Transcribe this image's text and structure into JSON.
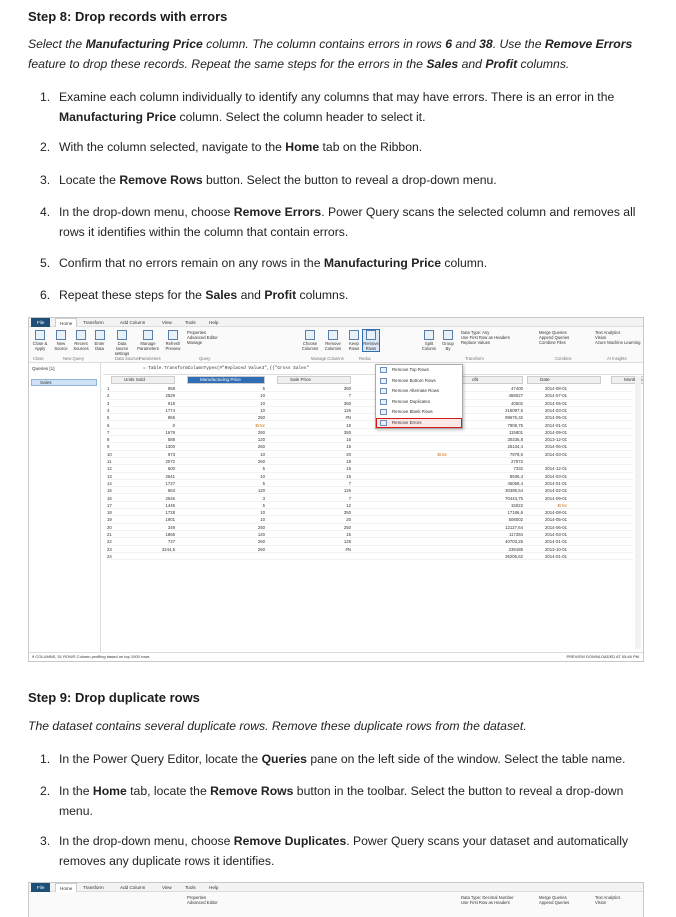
{
  "step8": {
    "heading": "Step 8: Drop records with errors",
    "intro_parts": [
      "Select the ",
      "Manufacturing Price",
      " column. The column contains errors in rows ",
      "6",
      " and ",
      "38",
      ". Use the ",
      "Remove Errors",
      " feature to drop these records. Repeat the same steps for the errors in the ",
      "Sales",
      " and ",
      "Profit",
      " columns."
    ],
    "items": [
      {
        "num": "1.",
        "parts": [
          "Examine each column individually to identify any columns that may have errors. There is an error in the ",
          "Manufacturing Price",
          " column. Select the column header to select it."
        ]
      },
      {
        "num": "2.",
        "parts": [
          "With the column selected, navigate to the ",
          "Home",
          " tab on the Ribbon."
        ]
      },
      {
        "num": "3.",
        "parts": [
          "Locate the ",
          "Remove Rows",
          " button. Select the button to reveal a drop-down menu."
        ]
      },
      {
        "num": "4.",
        "parts": [
          "In the drop-down menu, choose ",
          "Remove Errors",
          ". Power Query scans the selected column and removes all rows it identifies within the column that contain errors."
        ]
      },
      {
        "num": "5.",
        "parts": [
          "Confirm that no errors remain on any rows in the ",
          "Manufacturing Price",
          " column."
        ]
      },
      {
        "num": "6.",
        "parts": [
          "Repeat these steps for the ",
          "Sales",
          " and ",
          "Profit",
          " columns."
        ]
      }
    ]
  },
  "pq": {
    "tabs": [
      "File",
      "Home",
      "Transform",
      "Add Column",
      "View",
      "Tools",
      "Help"
    ],
    "ribbon_buttons": [
      "Close & Apply",
      "New Source",
      "Recent Sources",
      "Enter Data",
      "Data source settings",
      "Manage Parameters",
      "Refresh Preview",
      "Choose Columns",
      "Remove Columns",
      "Keep Rows",
      "Remove Rows",
      "Split Column",
      "Group By"
    ],
    "ribbon_small": [
      "Properties",
      "Advanced Editor",
      "Manage",
      "Data Type: Any",
      "Use First Row as Headers",
      "Replace Values",
      "Merge Queries",
      "Append Queries",
      "Combine Files",
      "Text Analytics",
      "Vision",
      "Azure Machine Learning"
    ],
    "groups": [
      "Close",
      "New Query",
      "Data Sources",
      "Parameters",
      "Query",
      "Manage Columns",
      "Reduc",
      "Transform",
      "Combine",
      "AI Insights"
    ],
    "queries_label": "Queries [1]",
    "query_name": "Sales",
    "formula": "= Table.TransformColumnTypes(#\"Replaced Value3\",{{\"Gross Sales\"",
    "columns": [
      "Units Sold",
      "Manufacturing Price",
      "Sale Price",
      "ofit",
      "Date",
      "Month Number"
    ],
    "menu": [
      "Remove Top Rows",
      "Remove Bottom Rows",
      "Remove Alternate Rows",
      "Remove Duplicates",
      "Remove Blank Rows",
      "Remove Errors"
    ],
    "rows": [
      [
        "1",
        "958",
        "5",
        "350",
        "",
        "47400",
        "2014-08-01",
        "8"
      ],
      [
        "2",
        "2529",
        "10",
        "7",
        "",
        "468027",
        "2014-07-01",
        "7"
      ],
      [
        "3",
        "918",
        "10",
        "350",
        "",
        "40502",
        "2014-05-01",
        "5"
      ],
      [
        "4",
        "1774",
        "10",
        "125",
        "",
        "215097,5",
        "2014-03-01",
        "3"
      ],
      [
        "5",
        "866",
        "250",
        "#N",
        "",
        "99676,32",
        "2014-05-01",
        "5"
      ],
      [
        "6",
        "0",
        "Error",
        "15",
        "",
        "7908,75",
        "2014-01-01",
        "1"
      ],
      [
        "7",
        "1679",
        "260",
        "350",
        "",
        "115801",
        "2014-09-01",
        "9"
      ],
      [
        "8",
        "588",
        "120",
        "15",
        "",
        "30336,8",
        "2013-12-01",
        "12"
      ],
      [
        "9",
        "1300",
        "260",
        "15",
        "",
        "25134,4",
        "2014-06-01",
        "6"
      ],
      [
        "10",
        "973",
        "10",
        "20",
        "Error",
        "7978,6",
        "2014-03-01",
        "3"
      ],
      [
        "11",
        "2072",
        "260",
        "15",
        "",
        "27972",
        "",
        "5"
      ],
      [
        "12",
        "600",
        "5",
        "15",
        "",
        "7332",
        "2014-12-01",
        "12"
      ],
      [
        "13",
        "2641",
        "10",
        "15",
        "",
        "8936,4",
        "2014-03-01",
        "3"
      ],
      [
        "14",
        "1727",
        "5",
        "7",
        "",
        "45058,4",
        "2014-01-01",
        "2"
      ],
      [
        "15",
        "663",
        "120",
        "125",
        "",
        "30396,54",
        "2014-02-01",
        "10"
      ],
      [
        "16",
        "2546",
        "3",
        "7",
        "",
        "70443,75",
        "2014-09-01",
        "9"
      ],
      [
        "17",
        "1445",
        "5",
        "12",
        "",
        "15022",
        "Error",
        "9"
      ],
      [
        "18",
        "1728",
        "10",
        "350",
        "",
        "17186,6",
        "2014-08-01",
        "9"
      ],
      [
        "19",
        "1901",
        "10",
        "20",
        "",
        "508002",
        "2014-05-01",
        "5"
      ],
      [
        "20",
        "349",
        "250",
        "250",
        "",
        "12127,64",
        "2014-06-01",
        "6"
      ],
      [
        "21",
        "1865",
        "120",
        "15",
        "",
        "117284",
        "2014-03-01",
        "9"
      ],
      [
        "22",
        "727",
        "260",
        "125",
        "",
        "40703,25",
        "2014-01-01",
        "10"
      ],
      [
        "23",
        "3244,5",
        "250",
        "#N",
        "",
        "239185",
        "2013-10-01",
        "1"
      ],
      [
        "24",
        "",
        "",
        "",
        "",
        "36206,62",
        "2014-01-01",
        ""
      ]
    ],
    "status_left": "9 COLUMNS, 51 ROWS   Column profiling based on top 1000 rows",
    "status_right": "PREVIEW DOWNLOADED AT 05:46 PM"
  },
  "step9": {
    "heading": "Step 9: Drop duplicate rows",
    "intro": "The dataset contains several duplicate rows. Remove these duplicate rows from the dataset.",
    "items": [
      {
        "num": "1.",
        "parts": [
          "In the Power Query Editor, locate the ",
          "Queries",
          " pane on the left side of the window. Select the table name."
        ]
      },
      {
        "num": "2.",
        "parts": [
          "In the ",
          "Home",
          " tab, locate the ",
          "Remove Rows",
          " button in the toolbar. Select the button to reveal a drop-down menu."
        ]
      },
      {
        "num": "3.",
        "parts": [
          "In the drop-down menu, choose ",
          "Remove Duplicates",
          ". Power Query scans your dataset and automatically removes any duplicate rows it identifies."
        ]
      }
    ]
  },
  "pq2": {
    "tabs": [
      "File",
      "Home",
      "Transform",
      "Add Column",
      "View",
      "Tools",
      "Help"
    ],
    "ribbon_small": [
      "Properties",
      "Advanced Editor",
      "Data Type: Decimal Number",
      "Use First Row as Headers",
      "Merge Queries",
      "Append Queries",
      "Text Analytics",
      "Vision"
    ]
  }
}
